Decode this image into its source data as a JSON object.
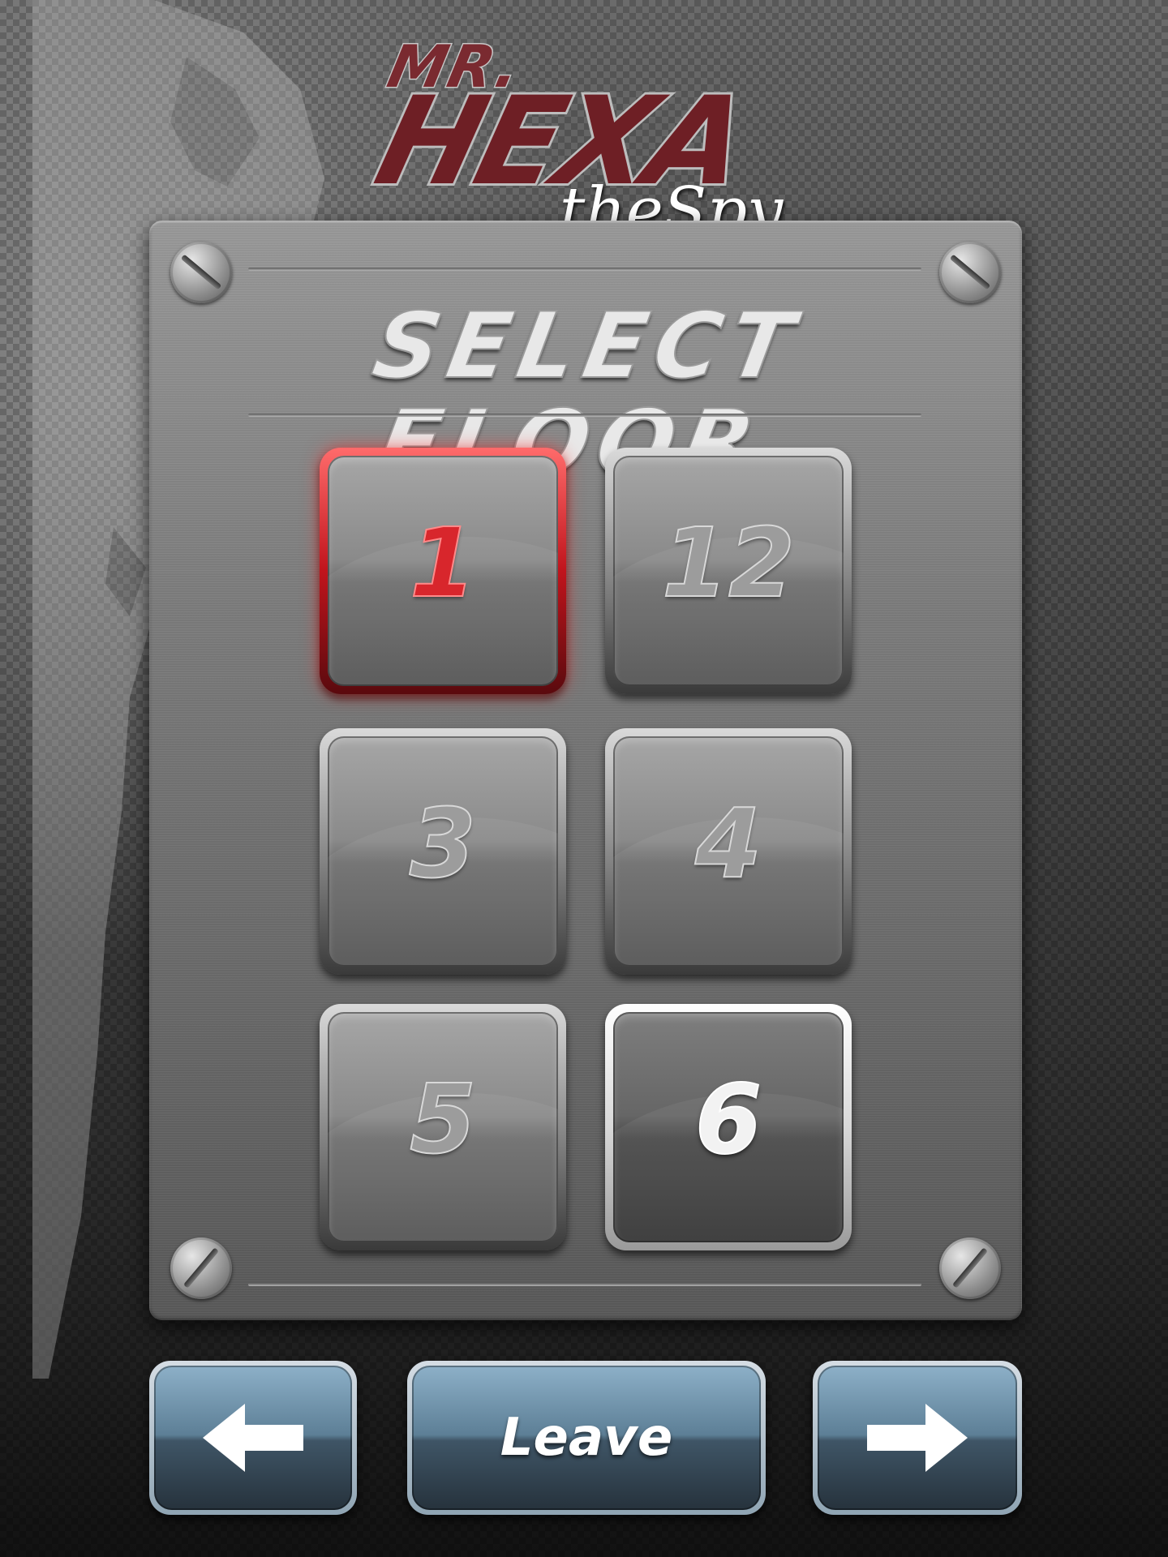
{
  "logo": {
    "mr": "MR.",
    "hexa": "HEXA",
    "the_spy": "theSpy"
  },
  "panel": {
    "title": "SELECT FLOOR"
  },
  "floors": [
    {
      "label": "1",
      "state": "selected"
    },
    {
      "label": "12",
      "state": "normal"
    },
    {
      "label": "3",
      "state": "normal"
    },
    {
      "label": "4",
      "state": "normal"
    },
    {
      "label": "5",
      "state": "normal"
    },
    {
      "label": "6",
      "state": "current"
    }
  ],
  "nav": {
    "back_icon": "arrow-left-icon",
    "leave_label": "Leave",
    "forward_icon": "arrow-right-icon"
  },
  "colors": {
    "selected_accent": "#d8262c",
    "nav_blue": "#5d7f96"
  }
}
